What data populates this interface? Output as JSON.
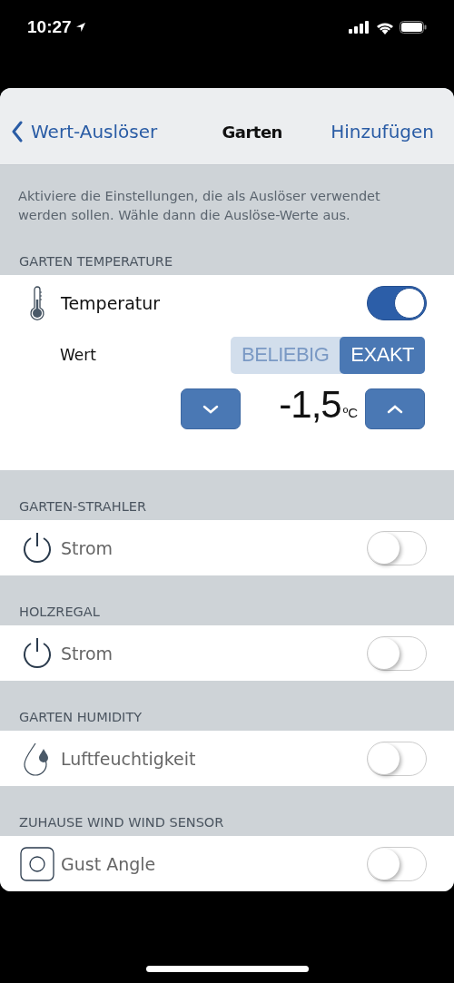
{
  "status_bar": {
    "time": "10:27"
  },
  "nav": {
    "back": "Wert-Auslöser",
    "title": "Garten",
    "action": "Hinzufügen"
  },
  "description": "Aktiviere die Einstellungen, die als Auslöser verwendet werden sollen. Wähle dann die Auslöse-Werte aus.",
  "sections": [
    {
      "header": "GARTEN TEMPERATURE",
      "rows": [
        {
          "kind": "thermometer",
          "label": "Temperatur",
          "on": true,
          "detail": {
            "label": "Wert",
            "options": [
              {
                "label": "BELIEBIG",
                "selected": false
              },
              {
                "label": "EXAKT",
                "selected": true
              }
            ],
            "value": "-1,5",
            "unit": "ºC"
          }
        }
      ]
    },
    {
      "header": "GARTEN-STRAHLER",
      "rows": [
        {
          "kind": "power",
          "label": "Strom",
          "on": false
        }
      ]
    },
    {
      "header": "HOLZREGAL",
      "rows": [
        {
          "kind": "power",
          "label": "Strom",
          "on": false
        }
      ]
    },
    {
      "header": "GARTEN HUMIDITY",
      "rows": [
        {
          "kind": "drop",
          "label": "Luftfeuchtigkeit",
          "on": false
        }
      ]
    },
    {
      "header": "ZUHAUSE WIND WIND SENSOR",
      "rows": [
        {
          "kind": "sensor",
          "label": "Gust Angle",
          "on": false
        }
      ]
    }
  ]
}
